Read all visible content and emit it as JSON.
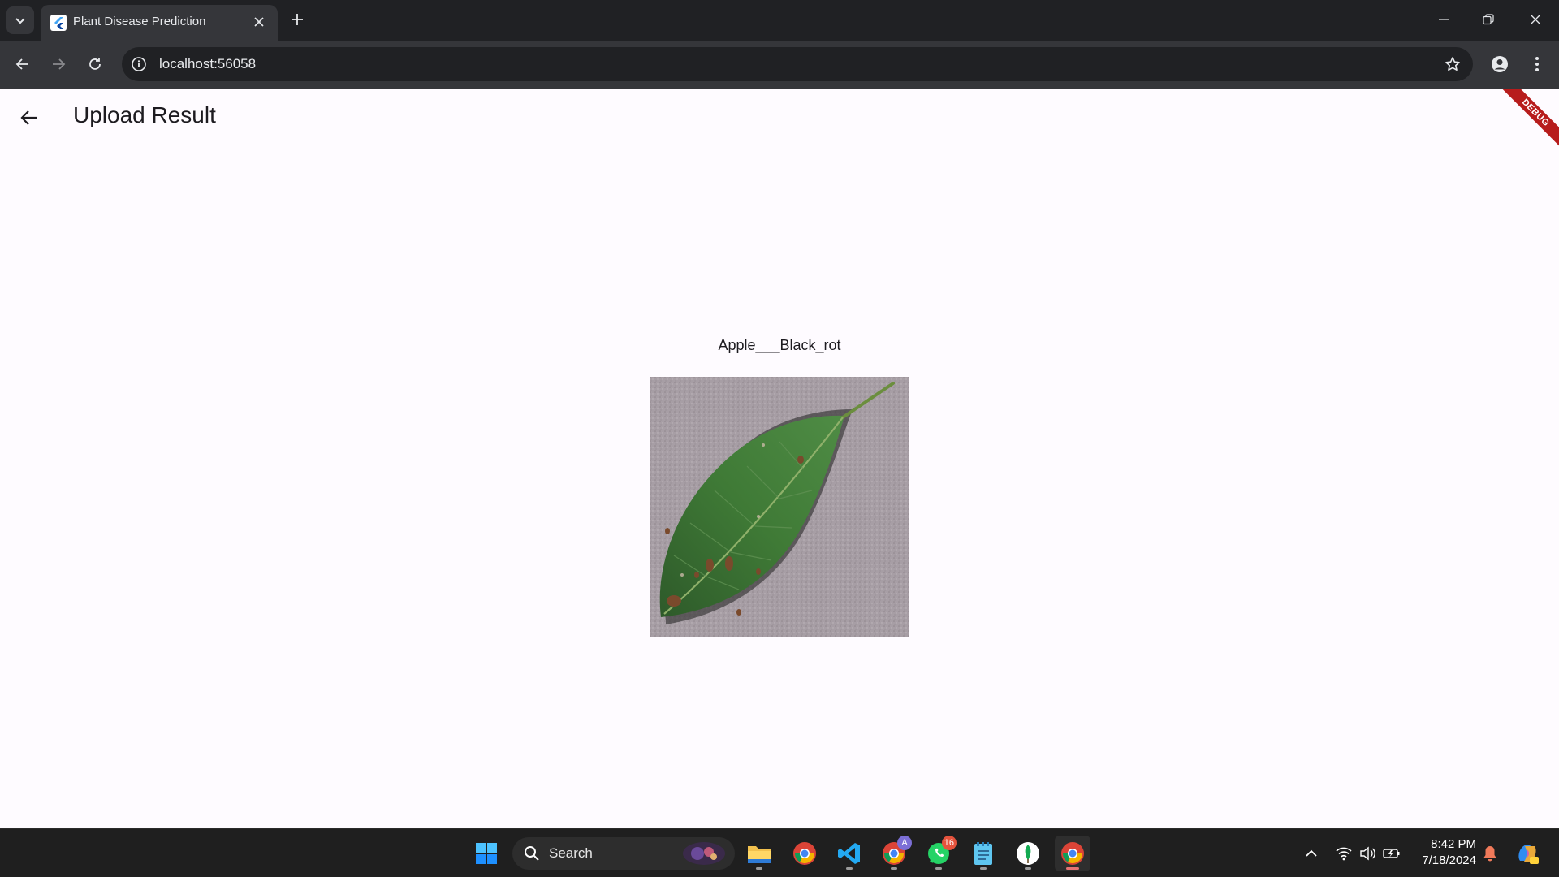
{
  "browser": {
    "tab": {
      "title": "Plant Disease Prediction"
    },
    "address_bar": {
      "url": "localhost:56058"
    }
  },
  "app": {
    "title": "Upload Result",
    "debug_banner": "DEBUG",
    "prediction_label": "Apple___Black_rot",
    "image_description_icon": "leaf-photo"
  },
  "taskbar": {
    "search_label": "Search",
    "apps": [
      {
        "icon": "windows-start-icon"
      },
      {
        "icon": "file-explorer-icon"
      },
      {
        "icon": "chrome-icon"
      },
      {
        "icon": "vscode-icon"
      },
      {
        "icon": "chrome-profile-icon",
        "badge": "A"
      },
      {
        "icon": "whatsapp-icon",
        "badge": "16"
      },
      {
        "icon": "notepad-icon"
      },
      {
        "icon": "mongodb-compass-icon"
      },
      {
        "icon": "chrome-active-icon"
      }
    ],
    "clock": {
      "time": "8:42 PM",
      "date": "7/18/2024"
    }
  },
  "colors": {
    "chrome_dark": "#202124",
    "chrome_toolbar": "#35363a",
    "app_background": "#fefbff",
    "debug_red": "#b71c1c",
    "taskbar": "#1f1f1f"
  }
}
